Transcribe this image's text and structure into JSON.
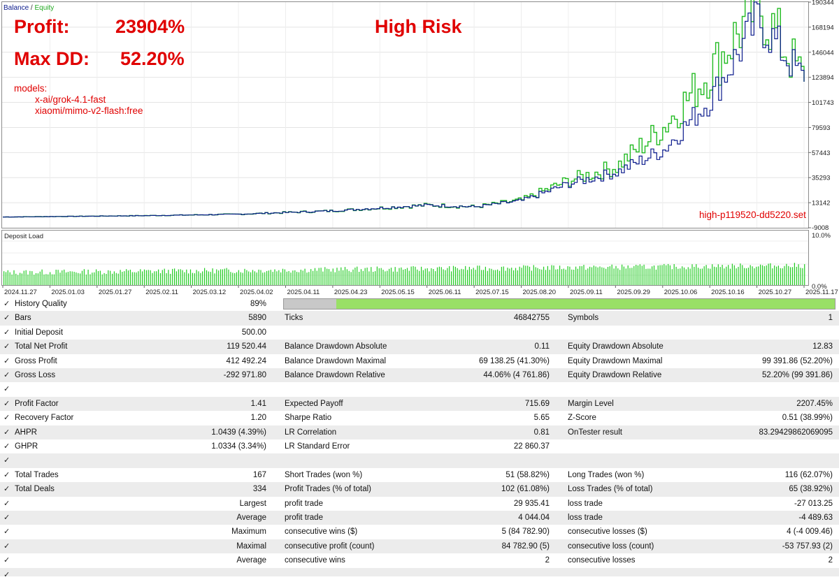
{
  "chart": {
    "legend": {
      "balance": "Balance",
      "sep": " / ",
      "equity": "Equity"
    },
    "overlay": {
      "profit_label": "Profit:",
      "profit_value": "23904%",
      "maxdd_label": "Max DD:",
      "maxdd_value": "52.20%",
      "risk": "High Risk",
      "models_label": "models:",
      "models": [
        "x-ai/grok-4.1-fast",
        "xiaomi/mimo-v2-flash:free"
      ],
      "set_name": "high-p119520-dd5220.set"
    },
    "colors": {
      "balance": "#0a1a8c",
      "equity": "#22bb22",
      "overlay_text": "#e00000",
      "deposit_bar": "#22cc22"
    }
  },
  "chart_data": {
    "type": "line",
    "x": [
      "2024.11.27",
      "2025.01.03",
      "2025.01.27",
      "2025.02.11",
      "2025.03.12",
      "2025.04.02",
      "2025.04.11",
      "2025.04.23",
      "2025.05.15",
      "2025.06.11",
      "2025.07.15",
      "2025.08.20",
      "2025.09.11",
      "2025.09.29",
      "2025.10.06",
      "2025.10.16",
      "2025.10.27",
      "2025.11.17"
    ],
    "series": [
      {
        "name": "Balance",
        "values": [
          500,
          900,
          1300,
          1700,
          2300,
          3000,
          4500,
          6000,
          8500,
          11000,
          9500,
          15000,
          30000,
          40000,
          60000,
          105000,
          175000,
          120000
        ]
      },
      {
        "name": "Equity",
        "values": [
          500,
          900,
          1300,
          1700,
          2300,
          3000,
          4500,
          6000,
          8500,
          11000,
          9500,
          15500,
          33000,
          45000,
          80000,
          130000,
          188000,
          120000
        ]
      }
    ],
    "y_ticks": [
      "190344",
      "168194",
      "146044",
      "123894",
      "101743",
      "79593",
      "57443",
      "35293",
      "13142",
      "-9008"
    ],
    "ylim": [
      -9008,
      190344
    ]
  },
  "deposit_load": {
    "title": "Deposit Load",
    "y_ticks": [
      "10.0%",
      "0.0%"
    ],
    "bar_count": 400
  },
  "history_quality": {
    "label": "History Quality",
    "value": "89%",
    "fraction": 0.89
  },
  "stats": {
    "r1": {
      "l1": "Bars",
      "v1": "5890",
      "l2": "Ticks",
      "v2": "46842755",
      "l3": "Symbols",
      "v3": "1"
    },
    "r2": {
      "l1": "Initial Deposit",
      "v1": "500.00"
    },
    "r3": {
      "l1": "Total Net Profit",
      "v1": "119 520.44",
      "l2": "Balance Drawdown Absolute",
      "v2": "0.11",
      "l3": "Equity Drawdown Absolute",
      "v3": "12.83"
    },
    "r4": {
      "l1": "Gross Profit",
      "v1": "412 492.24",
      "l2": "Balance Drawdown Maximal",
      "v2": "69 138.25 (41.30%)",
      "l3": "Equity Drawdown Maximal",
      "v3": "99 391.86 (52.20%)"
    },
    "r5": {
      "l1": "Gross Loss",
      "v1": "-292 971.80",
      "l2": "Balance Drawdown Relative",
      "v2": "44.06% (4 761.86)",
      "l3": "Equity Drawdown Relative",
      "v3": "52.20% (99 391.86)"
    },
    "r7": {
      "l1": "Profit Factor",
      "v1": "1.41",
      "l2": "Expected Payoff",
      "v2": "715.69",
      "l3": "Margin Level",
      "v3": "2207.45%"
    },
    "r8": {
      "l1": "Recovery Factor",
      "v1": "1.20",
      "l2": "Sharpe Ratio",
      "v2": "5.65",
      "l3": "Z-Score",
      "v3": "0.51 (38.99%)"
    },
    "r9": {
      "l1": "AHPR",
      "v1": "1.0439 (4.39%)",
      "l2": "LR Correlation",
      "v2": "0.81",
      "l3": "OnTester result",
      "v3": "83.29429862069095"
    },
    "r10": {
      "l1": "GHPR",
      "v1": "1.0334 (3.34%)",
      "l2": "LR Standard Error",
      "v2": "22 860.37"
    },
    "r12": {
      "l1": "Total Trades",
      "v1": "167",
      "l2": "Short Trades (won %)",
      "v2": "51 (58.82%)",
      "l3": "Long Trades (won %)",
      "v3": "116 (62.07%)"
    },
    "r13": {
      "l1": "Total Deals",
      "v1": "334",
      "l2": "Profit Trades (% of total)",
      "v2": "102 (61.08%)",
      "l3": "Loss Trades (% of total)",
      "v3": "65 (38.92%)"
    },
    "r14": {
      "v1": "Largest",
      "l2": "profit trade",
      "v2": "29 935.41",
      "l3": "loss trade",
      "v3": "-27 013.25"
    },
    "r15": {
      "v1": "Average",
      "l2": "profit trade",
      "v2": "4 044.04",
      "l3": "loss trade",
      "v3": "-4 489.63"
    },
    "r16": {
      "v1": "Maximum",
      "l2": "consecutive wins ($)",
      "v2": "5 (84 782.90)",
      "l3": "consecutive losses ($)",
      "v3": "4 (-4 009.46)"
    },
    "r17": {
      "v1": "Maximal",
      "l2": "consecutive profit (count)",
      "v2": "84 782.90 (5)",
      "l3": "consecutive loss (count)",
      "v3": "-53 757.93 (2)"
    },
    "r18": {
      "v1": "Average",
      "l2": "consecutive wins",
      "v2": "2",
      "l3": "consecutive losses",
      "v3": "2"
    }
  },
  "check": "✓"
}
